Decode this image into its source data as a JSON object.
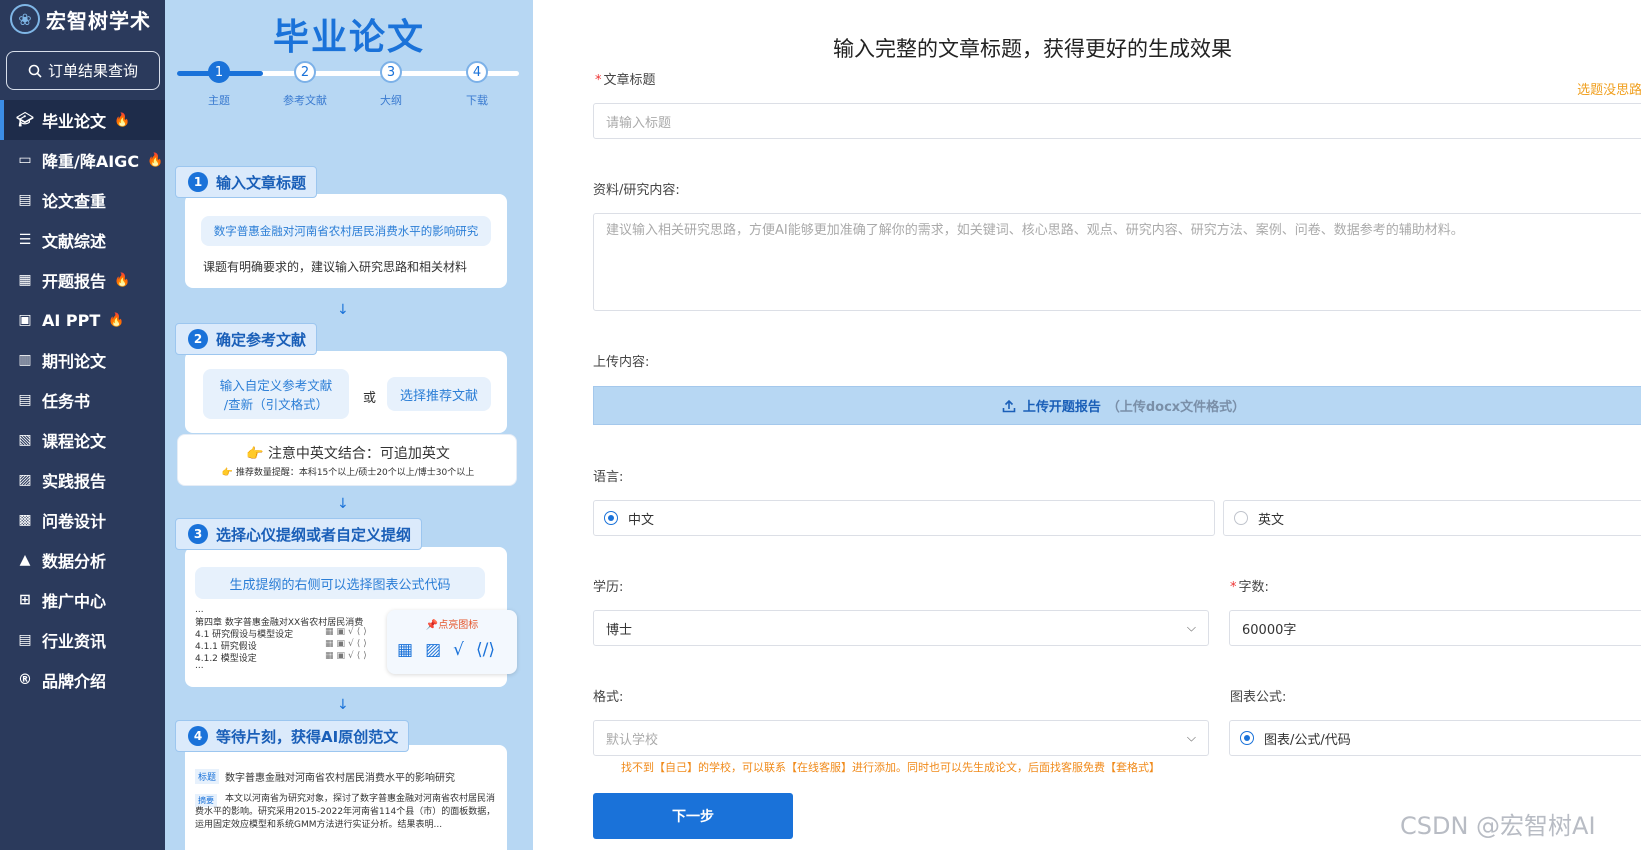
{
  "brand": {
    "name": "宏智树学术"
  },
  "sidebar": {
    "query_label": "订单结果查询",
    "items": [
      {
        "label": "毕业论文",
        "icon": "cap-icon",
        "hot": true,
        "active": true
      },
      {
        "label": "降重/降AIGC",
        "icon": "book-icon",
        "hot": true
      },
      {
        "label": "论文查重",
        "icon": "doc-icon",
        "hot": false
      },
      {
        "label": "文献综述",
        "icon": "list-icon",
        "hot": false
      },
      {
        "label": "开题报告",
        "icon": "report-icon",
        "hot": true
      },
      {
        "label": "AI PPT",
        "icon": "ppt-icon",
        "hot": true
      },
      {
        "label": "期刊论文",
        "icon": "journal-icon",
        "hot": false
      },
      {
        "label": "任务书",
        "icon": "task-icon",
        "hot": false
      },
      {
        "label": "课程论文",
        "icon": "course-icon",
        "hot": false
      },
      {
        "label": "实践报告",
        "icon": "practice-icon",
        "hot": false
      },
      {
        "label": "问卷设计",
        "icon": "survey-icon",
        "hot": false
      },
      {
        "label": "数据分析",
        "icon": "chart-icon",
        "hot": false
      },
      {
        "label": "推广中心",
        "icon": "grid-icon",
        "hot": false
      },
      {
        "label": "行业资讯",
        "icon": "news-icon",
        "hot": false
      },
      {
        "label": "品牌介绍",
        "icon": "registered-icon",
        "hot": false
      }
    ]
  },
  "guide": {
    "title": "毕业论文",
    "steps": [
      {
        "num": "1",
        "label": "主题"
      },
      {
        "num": "2",
        "label": "参考文献"
      },
      {
        "num": "3",
        "label": "大纲"
      },
      {
        "num": "4",
        "label": "下载"
      }
    ],
    "card1": {
      "tag_num": "1",
      "tag": "输入文章标题",
      "example": "数字普惠金融对河南省农村居民消费水平的影响研究",
      "note": "课题有明确要求的，建议输入研究思路和相关材料"
    },
    "card2": {
      "tag_num": "2",
      "tag": "确定参考文献",
      "custom": "输入自定义参考文献\n/查新（引文格式）",
      "or": "或",
      "recommend": "选择推荐文献",
      "tip": "注意中英文结合：可追加英文",
      "tip_small": "推荐数量提醒：本科15个以上/硕士20个以上/博士30个以上"
    },
    "card3": {
      "tag_num": "3",
      "tag": "选择心仪提纲或者自定义提纲",
      "pill": "生成提纲的右侧可以选择图表公式代码",
      "ellipsis_top": "...",
      "chapter": "第四章 数字普惠金融对XX省农村居民消费",
      "lines": [
        "4.1 研究假设与模型设定",
        "4.1.1 研究假设",
        "4.1.2 模型设定"
      ],
      "ellipsis_bottom": "...",
      "popup_title": "点亮图标"
    },
    "card4": {
      "tag_num": "4",
      "tag": "等待片刻，获得AI原创范文",
      "title_tag": "标题",
      "title_text": "数字普惠金融对河南省农村居民消费水平的影响研究",
      "abstract_tag": "摘要",
      "abstract_text": "本文以河南省为研究对象，探讨了数字普惠金融对河南省农村居民消费水平的影响。研究采用2015-2022年河南省114个县（市）的面板数据，运用固定效应模型和系统GMM方法进行实证分析。结果表明..."
    }
  },
  "form": {
    "heading": "输入完整的文章标题，获得更好的生成效果",
    "title_label": "文章标题",
    "title_hint": "选题没思路?",
    "title_placeholder": "请输入标题",
    "content_label": "资料/研究内容:",
    "content_placeholder": "建议输入相关研究思路，方便AI能够更加准确了解你的需求，如关键词、核心思路、观点、研究内容、研究方法、案例、问卷、数据参考的辅助材料。",
    "upload_label": "上传内容:",
    "upload_button": "上传开题报告",
    "upload_sub": "（上传docx文件格式）",
    "language_label": "语言:",
    "lang_cn": "中文",
    "lang_en": "英文",
    "degree_label": "学历:",
    "degree_value": "博士",
    "words_label": "字数:",
    "words_value": "60000字",
    "format_label": "格式:",
    "format_placeholder": "默认学校",
    "chart_label": "图表公式:",
    "chart_option": "图表/公式/代码",
    "warning": "找不到【自己】的学校，可以联系【在线客服】进行添加。同时也可以先生成论文，后面找客服免费【套格式】",
    "next": "下一步"
  },
  "watermark": "CSDN @宏智树AI",
  "colors": {
    "sidebar_bg": "#2b3a5c",
    "accent": "#1a72d9",
    "guide_bg": "#b7d7f3",
    "warn": "#f08a1a"
  }
}
